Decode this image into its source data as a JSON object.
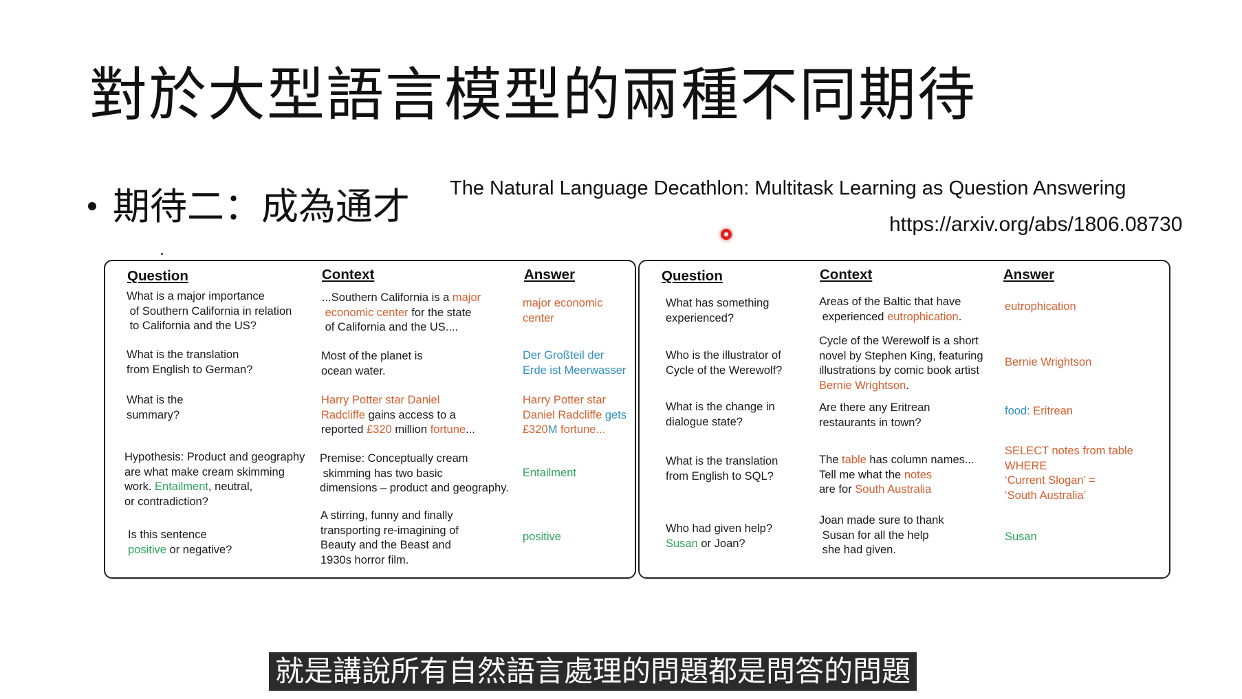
{
  "slide": {
    "title": "對於大型語言模型的兩種不同期待",
    "bullet": "期待二：成為通才",
    "paper_title": "The Natural Language Decathlon: Multitask Learning as Question Answering",
    "paper_url": "https://arxiv.org/abs/1806.08730"
  },
  "headers": {
    "question": "Question",
    "context": "Context",
    "answer": "Answer"
  },
  "left_rows": [
    {
      "question": [
        {
          "t": "What is a major importance\n of Southern California in relation\n to California and the US?"
        }
      ],
      "context": [
        {
          "t": "...Southern California is a "
        },
        {
          "t": "major\n economic center",
          "c": "o"
        },
        {
          "t": " for the state\n of California and the US...."
        }
      ],
      "answer": [
        {
          "t": "major economic\ncenter",
          "c": "o"
        }
      ]
    },
    {
      "question": [
        {
          "t": "What is the translation\nfrom English to German?"
        }
      ],
      "context": [
        {
          "t": "Most of the planet is\nocean water."
        }
      ],
      "answer": [
        {
          "t": "Der Großteil der\nErde ist Meerwasser",
          "c": "b"
        }
      ]
    },
    {
      "question": [
        {
          "t": "What is the\nsummary?"
        }
      ],
      "context": [
        {
          "t": "Harry Potter star Daniel\nRadcliffe",
          "c": "o"
        },
        {
          "t": " gains access to a\nreported "
        },
        {
          "t": "£320",
          "c": "o"
        },
        {
          "t": " million "
        },
        {
          "t": "fortune",
          "c": "o"
        },
        {
          "t": "..."
        }
      ],
      "answer": [
        {
          "t": "Harry Potter star\nDaniel Radcliffe",
          "c": "o"
        },
        {
          "t": " gets\n",
          "c": "b"
        },
        {
          "t": "£320",
          "c": "o"
        },
        {
          "t": "M",
          "c": "b"
        },
        {
          "t": " fortune...",
          "c": "o"
        }
      ]
    },
    {
      "question": [
        {
          "t": "Hypothesis: Product and geography\nare what make cream  skimming\nwork. "
        },
        {
          "t": "Entailment",
          "c": "g"
        },
        {
          "t": ", neutral,\nor contradiction?"
        }
      ],
      "context": [
        {
          "t": "Premise: Conceptually cream\n skimming has two basic\ndimensions – product and geography."
        }
      ],
      "answer": [
        {
          "t": "Entailment",
          "c": "g"
        }
      ]
    },
    {
      "question": [
        {
          "t": "Is this sentence\n"
        },
        {
          "t": "positive",
          "c": "g"
        },
        {
          "t": " or negative?"
        }
      ],
      "context": [
        {
          "t": "A stirring, funny and finally\ntransporting re-imagining of\nBeauty and the Beast and\n1930s horror film."
        }
      ],
      "answer": [
        {
          "t": "positive",
          "c": "g"
        }
      ]
    }
  ],
  "right_rows": [
    {
      "question": [
        {
          "t": "What has something\nexperienced?"
        }
      ],
      "context": [
        {
          "t": "Areas of the Baltic that have\n experienced "
        },
        {
          "t": "eutrophication",
          "c": "o"
        },
        {
          "t": "."
        }
      ],
      "answer": [
        {
          "t": "eutrophication",
          "c": "o"
        }
      ]
    },
    {
      "question": [
        {
          "t": "Who is the illustrator of\nCycle of the Werewolf?"
        }
      ],
      "context": [
        {
          "t": "Cycle of the Werewolf is a short\nnovel by Stephen King, featuring\nillustrations by comic book artist\n"
        },
        {
          "t": "Bernie Wrightson",
          "c": "o"
        },
        {
          "t": "."
        }
      ],
      "answer": [
        {
          "t": "Bernie Wrightson",
          "c": "o"
        }
      ]
    },
    {
      "question": [
        {
          "t": "What is the change in\ndialogue state?"
        }
      ],
      "context": [
        {
          "t": "Are there any Eritrean\nrestaurants in town?"
        }
      ],
      "answer": [
        {
          "t": "food: ",
          "c": "b"
        },
        {
          "t": "Eritrean",
          "c": "o"
        }
      ]
    },
    {
      "question": [
        {
          "t": "What is the translation\nfrom English to SQL?"
        }
      ],
      "context": [
        {
          "t": "The "
        },
        {
          "t": "table",
          "c": "o"
        },
        {
          "t": " has column names...\nTell me what the "
        },
        {
          "t": "notes",
          "c": "o"
        },
        {
          "t": "\nare for "
        },
        {
          "t": "South Australia",
          "c": "o"
        }
      ],
      "answer": [
        {
          "t": "SELECT notes from table\nWHERE\n‘Current Slogan’ =\n‘South Australia’",
          "c": "o"
        }
      ]
    },
    {
      "question": [
        {
          "t": "Who had given help?\n"
        },
        {
          "t": "Susan",
          "c": "g"
        },
        {
          "t": " or Joan?"
        }
      ],
      "context": [
        {
          "t": "Joan made sure to thank\n Susan for all the help\n she had given."
        }
      ],
      "answer": [
        {
          "t": "Susan",
          "c": "g"
        }
      ]
    }
  ],
  "subtitle": "就是講說所有自然語言處理的問題都是問答的問題",
  "colors": {
    "orange": "#d3602f",
    "green": "#2fa35a",
    "blue": "#2f8fc1"
  }
}
